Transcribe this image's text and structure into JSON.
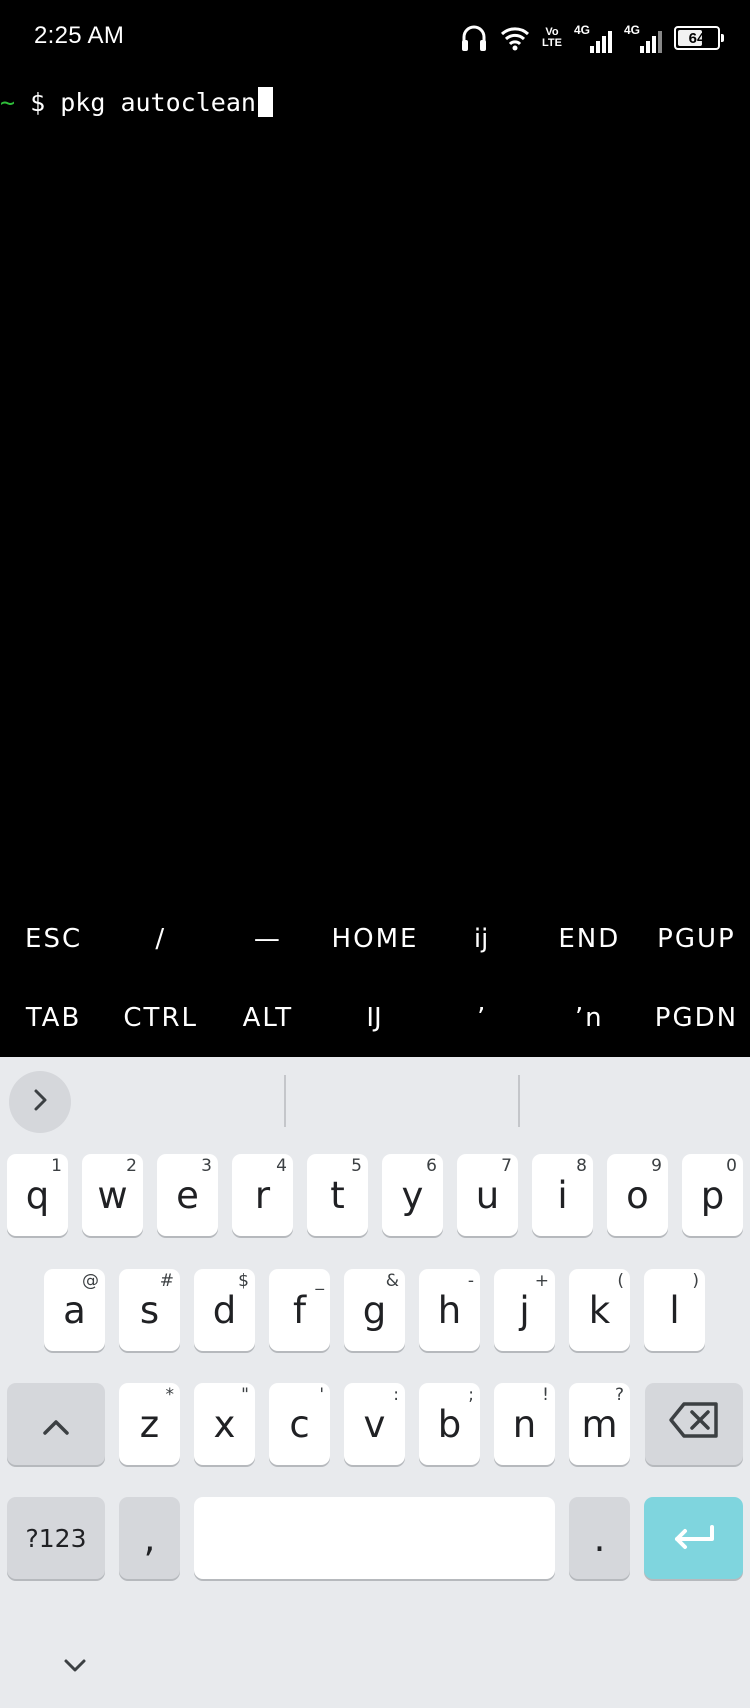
{
  "status_bar": {
    "time": "2:25 AM",
    "icons": [
      "headphones-icon",
      "wifi-icon",
      "volte-icon",
      "signal-icon",
      "signal-icon",
      "battery-icon"
    ],
    "volte_line1": "Vo",
    "volte_line2": "LTE",
    "sim1_network": "4G",
    "sim2_network": "4G",
    "battery_level": "64",
    "battery_fraction": 0.64
  },
  "terminal": {
    "prompt_tilde": "~",
    "prompt_dollar": "$",
    "command": "pkg autoclean"
  },
  "extra_keys": {
    "row1": [
      "ESC",
      "/",
      "—",
      "HOME",
      "ĳ",
      "END",
      "PGUP"
    ],
    "row2": [
      "TAB",
      "CTRL",
      "ALT",
      "Ĳ",
      "ʼ",
      "ʼn",
      "PGDN"
    ]
  },
  "keyboard": {
    "row1": [
      {
        "key": "q",
        "hint": "1"
      },
      {
        "key": "w",
        "hint": "2"
      },
      {
        "key": "e",
        "hint": "3"
      },
      {
        "key": "r",
        "hint": "4"
      },
      {
        "key": "t",
        "hint": "5"
      },
      {
        "key": "y",
        "hint": "6"
      },
      {
        "key": "u",
        "hint": "7"
      },
      {
        "key": "i",
        "hint": "8"
      },
      {
        "key": "o",
        "hint": "9"
      },
      {
        "key": "p",
        "hint": "0"
      }
    ],
    "row2": [
      {
        "key": "a",
        "hint": "@"
      },
      {
        "key": "s",
        "hint": "#"
      },
      {
        "key": "d",
        "hint": "$"
      },
      {
        "key": "f",
        "hint": "_"
      },
      {
        "key": "g",
        "hint": "&"
      },
      {
        "key": "h",
        "hint": "-"
      },
      {
        "key": "j",
        "hint": "+"
      },
      {
        "key": "k",
        "hint": "("
      },
      {
        "key": "l",
        "hint": ")"
      }
    ],
    "row3": [
      {
        "key": "z",
        "hint": "*"
      },
      {
        "key": "x",
        "hint": "\""
      },
      {
        "key": "c",
        "hint": "'"
      },
      {
        "key": "v",
        "hint": ":"
      },
      {
        "key": "b",
        "hint": ";"
      },
      {
        "key": "n",
        "hint": "!"
      },
      {
        "key": "m",
        "hint": "?"
      }
    ],
    "symbols_label": "?123",
    "comma_label": ",",
    "period_label": ".",
    "icons": [
      "chevron-right-icon",
      "shift-icon",
      "backspace-icon",
      "enter-icon",
      "chevron-down-icon"
    ],
    "colors": {
      "background": "#e8eaed",
      "key": "#ffffff",
      "special_key": "#d5d7db",
      "enter_key": "#7fd5de"
    }
  }
}
